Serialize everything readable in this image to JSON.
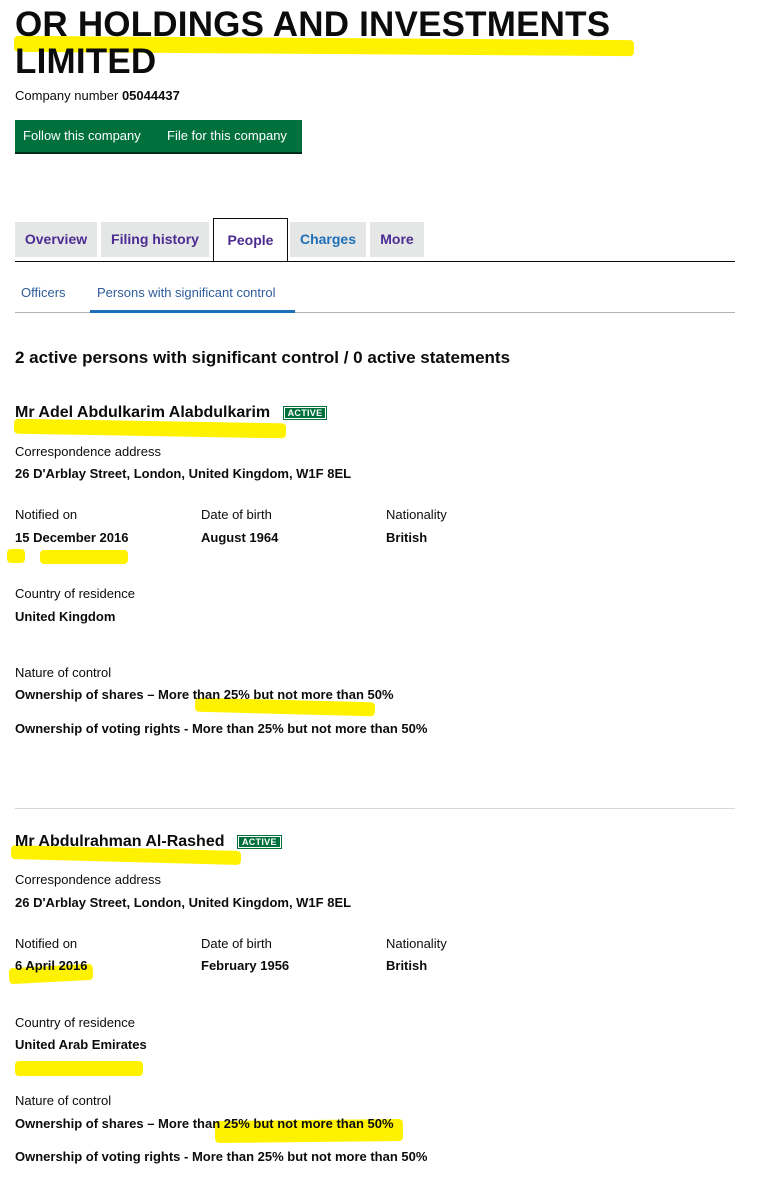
{
  "company": {
    "name": "OR HOLDINGS AND INVESTMENTS LIMITED",
    "number_label": "Company number",
    "number": "05044437"
  },
  "buttons": {
    "follow": "Follow this company",
    "file": "File for this company"
  },
  "tabs": [
    "Overview",
    "Filing history",
    "People",
    "Charges",
    "More"
  ],
  "subtabs": [
    "Officers",
    "Persons with significant control"
  ],
  "summary": "2 active persons with significant control / 0 active statements",
  "labels": {
    "correspondence": "Correspondence address",
    "notified": "Notified on",
    "dob": "Date of birth",
    "nationality": "Nationality",
    "residence": "Country of residence",
    "nature": "Nature of control"
  },
  "persons": [
    {
      "name": "Mr Adel Abdulkarim Alabdulkarim",
      "status": "ACTIVE",
      "address": "26 D'Arblay Street, London, United Kingdom, W1F 8EL",
      "notified_on": "15 December 2016",
      "dob": "August 1964",
      "nationality": "British",
      "residence": "United Kingdom",
      "control": [
        "Ownership of shares – More than 25% but not more than 50%",
        "Ownership of voting rights - More than 25% but not more than 50%"
      ]
    },
    {
      "name": "Mr Abdulrahman Al-Rashed",
      "status": "ACTIVE",
      "address": "26 D'Arblay Street, London, United Kingdom, W1F 8EL",
      "notified_on": "6 April 2016",
      "dob": "February 1956",
      "nationality": "British",
      "residence": "United Arab Emirates",
      "control": [
        "Ownership of shares – More than 25% but not more than 50%",
        "Ownership of voting rights - More than 25% but not more than 50%"
      ]
    }
  ],
  "colors": {
    "green": "#00703c",
    "link_purple": "#4c2c92",
    "link_blue": "#1d70b8",
    "highlighter": "#fff200"
  }
}
